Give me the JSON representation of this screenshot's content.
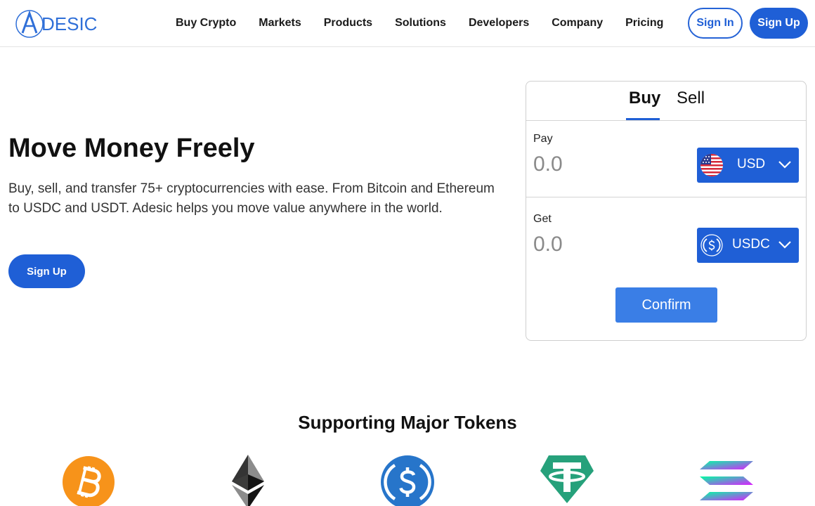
{
  "brand": {
    "name": "DESIC"
  },
  "nav": {
    "items": [
      {
        "label": "Buy Crypto"
      },
      {
        "label": "Markets"
      },
      {
        "label": "Products"
      },
      {
        "label": "Solutions"
      },
      {
        "label": "Developers"
      },
      {
        "label": "Company"
      },
      {
        "label": "Pricing"
      }
    ],
    "sign_in": "Sign In",
    "sign_up": "Sign Up"
  },
  "hero": {
    "title": "Move Money Freely",
    "subtitle": "Buy, sell, and transfer 75+ cryptocurrencies with ease. From Bitcoin and Ethereum to USDC and USDT. Adesic helps you move value anywhere in the world.",
    "cta": "Sign Up"
  },
  "trade": {
    "tabs": [
      {
        "label": "Buy",
        "active": true
      },
      {
        "label": "Sell",
        "active": false
      }
    ],
    "pay": {
      "label": "Pay",
      "value": "0.0",
      "currency": "USD",
      "icon": "us-flag-icon"
    },
    "get": {
      "label": "Get",
      "value": "0.0",
      "currency": "USDC",
      "icon": "usdc-icon"
    },
    "confirm": "Confirm"
  },
  "tokens": {
    "title": "Supporting Major Tokens",
    "icons": [
      "bitcoin-icon",
      "ethereum-icon",
      "usdc-icon",
      "tether-icon",
      "solana-icon"
    ]
  },
  "colors": {
    "primary": "#1f5fd6",
    "confirm": "#3a7ee6",
    "bitcoin": "#f7931a",
    "usdc": "#2775ca",
    "tether": "#26a17b"
  }
}
